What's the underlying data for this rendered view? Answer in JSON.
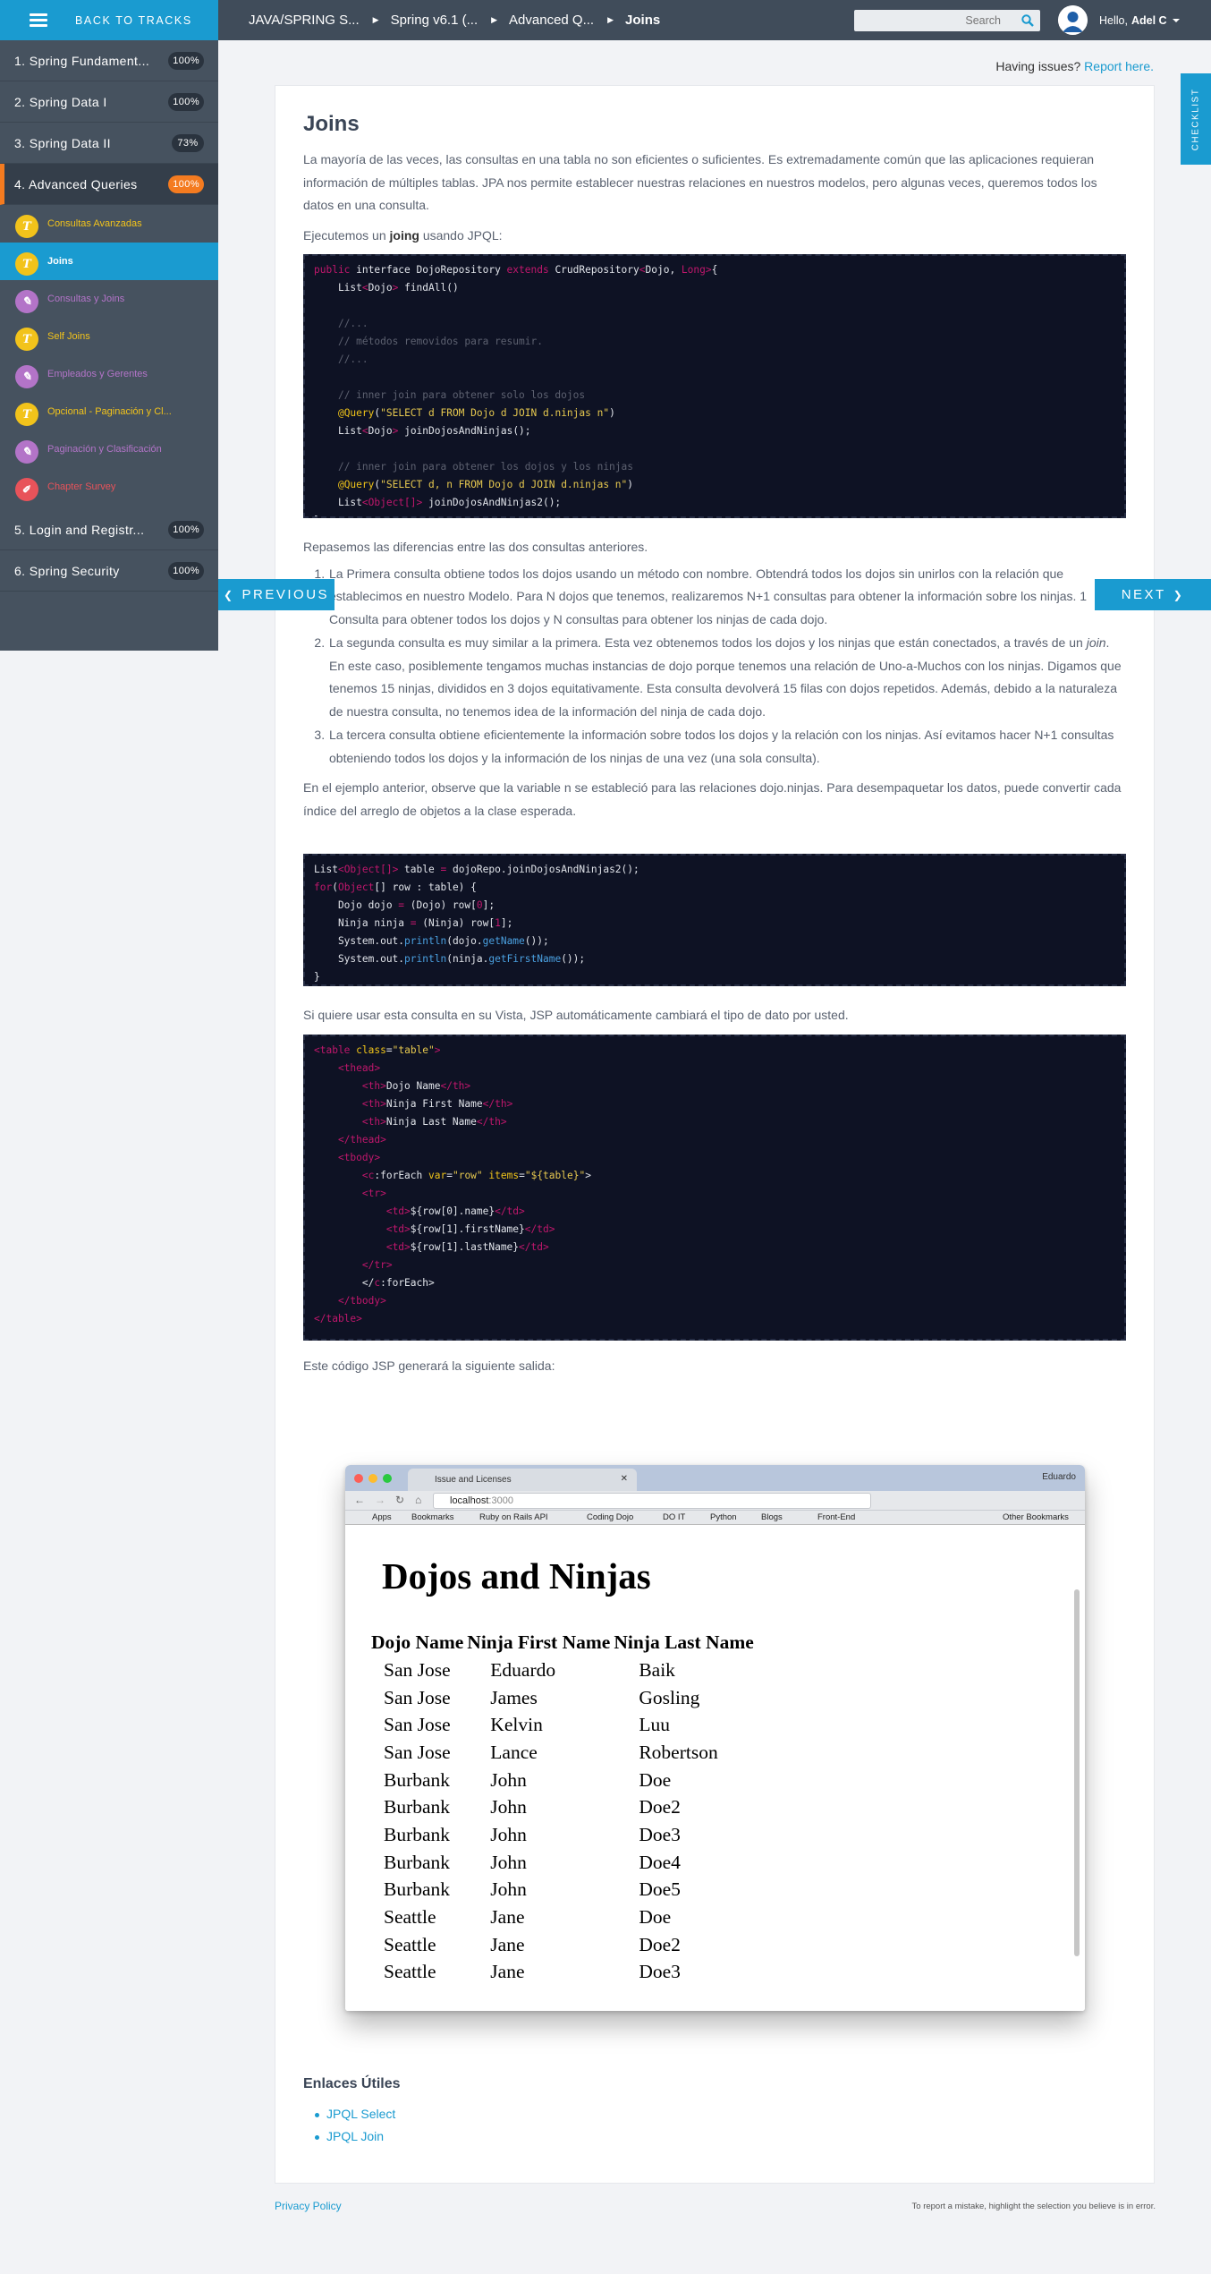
{
  "topbar": {
    "back_label": "BACK TO TRACKS",
    "crumbs": [
      "JAVA/SPRING S...",
      "Spring v6.1 (...",
      "Advanced Q...",
      "Joins"
    ],
    "search_placeholder": "Search",
    "hello": "Hello,",
    "user_name": "Adel C"
  },
  "sidebar": {
    "chapters": [
      {
        "label": "1. Spring Fundament...",
        "pct": "100%"
      },
      {
        "label": "2. Spring Data I",
        "pct": "100%"
      },
      {
        "label": "3. Spring Data II",
        "pct": "73%"
      },
      {
        "label": "4. Advanced Queries",
        "pct": "100%"
      },
      {
        "label": "5. Login and Registr...",
        "pct": "100%"
      },
      {
        "label": "6. Spring Security",
        "pct": "100%"
      }
    ],
    "lessons": [
      {
        "label": "Consultas Avanzadas",
        "icon": "text-icon",
        "color": "#f2c31b"
      },
      {
        "label": "Joins",
        "icon": "text-icon",
        "color": "#f2c31b"
      },
      {
        "label": "Consultas y Joins",
        "icon": "pencil-icon",
        "color": "#b374c8"
      },
      {
        "label": "Self Joins",
        "icon": "text-icon",
        "color": "#f2c31b"
      },
      {
        "label": "Empleados y Gerentes",
        "icon": "pencil-icon",
        "color": "#b374c8"
      },
      {
        "label": "Opcional - Paginación y Cl...",
        "icon": "text-icon",
        "color": "#f2c31b"
      },
      {
        "label": "Paginación y Clasificación",
        "icon": "pencil-icon",
        "color": "#b374c8"
      },
      {
        "label": "Chapter Survey",
        "icon": "survey-icon",
        "color": "#e8535a"
      }
    ]
  },
  "checklist": "CHECKLIST",
  "issues": {
    "text": "Having issues?",
    "link": "Report here."
  },
  "nav": {
    "prev": "PREVIOUS",
    "next": "NEXT"
  },
  "article": {
    "title": "Joins",
    "intro": "La mayoría de las veces, las consultas en una tabla no son eficientes o suficientes. Es extremadamente común que las aplicaciones requieran información de múltiples tablas. JPA nos permite establecer nuestras relaciones en nuestros modelos, pero algunas veces, queremos todos los datos en una consulta.",
    "run_a": "Ejecutemos un ",
    "run_b": "joing",
    "run_c": " usando JPQL:",
    "diff": "Repasemos las diferencias entre las dos consultas anteriores.",
    "li1": "La Primera consulta obtiene todos los dojos usando un método con nombre. Obtendrá todos los dojos sin unirlos con la relación que establecimos en nuestro Modelo. Para N dojos que tenemos, realizaremos N+1 consultas para obtener la información sobre los ninjas. 1 Consulta para obtener todos los dojos y N consultas para obtener los ninjas de cada dojo.",
    "li2_a": "La segunda consulta es muy similar a la primera. Esta vez obtenemos todos los dojos y los ninjas que están conectados, a través de un ",
    "li2_b": "join",
    "li2_c": ". En este caso, posiblemente tengamos muchas instancias de dojo porque tenemos una relación de Uno-a-Muchos con los ninjas. Digamos que tenemos 15 ninjas, divididos en 3 dojos equitativamente. Esta consulta devolverá 15 filas con dojos repetidos. Además, debido a la naturaleza de nuestra consulta, no tenemos idea de la información del ninja de cada dojo.",
    "li3": "La tercera consulta obtiene eficientemente la información sobre todos los dojos y la relación con los ninjas. Así evitamos hacer N+1 consultas obteniendo todos los dojos y la información de los ninjas de una vez (una sola consulta).",
    "example": "En el ejemplo anterior, observe que la variable n se estableció para las relaciones dojo.ninjas. Para desempaquetar los datos, puede convertir cada índice del arreglo de objetos a la clase esperada.",
    "view": "Si quiere usar esta consulta en su Vista, JSP automáticamente cambiará el tipo de dato por usted.",
    "output": "Este código JSP generará la siguiente salida:",
    "links_title": "Enlaces Útiles",
    "links": [
      "JPQL Select",
      "JPQL Join"
    ]
  },
  "browser": {
    "tab_title": "Issue and Licenses",
    "user": "Eduardo",
    "url_host": "localhost",
    "url_port": ":3000",
    "bookmarks": [
      "Apps",
      "Bookmarks",
      "Ruby on Rails API",
      "Coding Dojo",
      "DO IT",
      "Python",
      "Blogs",
      "Front-End",
      "Other Bookmarks"
    ],
    "heading": "Dojos and Ninjas",
    "headers": [
      "Dojo Name",
      "Ninja First Name",
      "Ninja Last Name"
    ],
    "rows": [
      [
        "San Jose",
        "Eduardo",
        "Baik"
      ],
      [
        "San Jose",
        "James",
        "Gosling"
      ],
      [
        "San Jose",
        "Kelvin",
        "Luu"
      ],
      [
        "San Jose",
        "Lance",
        "Robertson"
      ],
      [
        "Burbank",
        "John",
        "Doe"
      ],
      [
        "Burbank",
        "John",
        "Doe2"
      ],
      [
        "Burbank",
        "John",
        "Doe3"
      ],
      [
        "Burbank",
        "John",
        "Doe4"
      ],
      [
        "Burbank",
        "John",
        "Doe5"
      ],
      [
        "Seattle",
        "Jane",
        "Doe"
      ],
      [
        "Seattle",
        "Jane",
        "Doe2"
      ],
      [
        "Seattle",
        "Jane",
        "Doe3"
      ]
    ]
  },
  "footer": {
    "privacy": "Privacy Policy",
    "report": "To report a mistake, highlight the selection you believe is in error."
  },
  "colors": {
    "accent": "#1a9bd0",
    "topbar": "#404c5a",
    "sidebar": "#46525f",
    "progress_orange": "#f47b20",
    "code_bg": "#0e1224"
  }
}
